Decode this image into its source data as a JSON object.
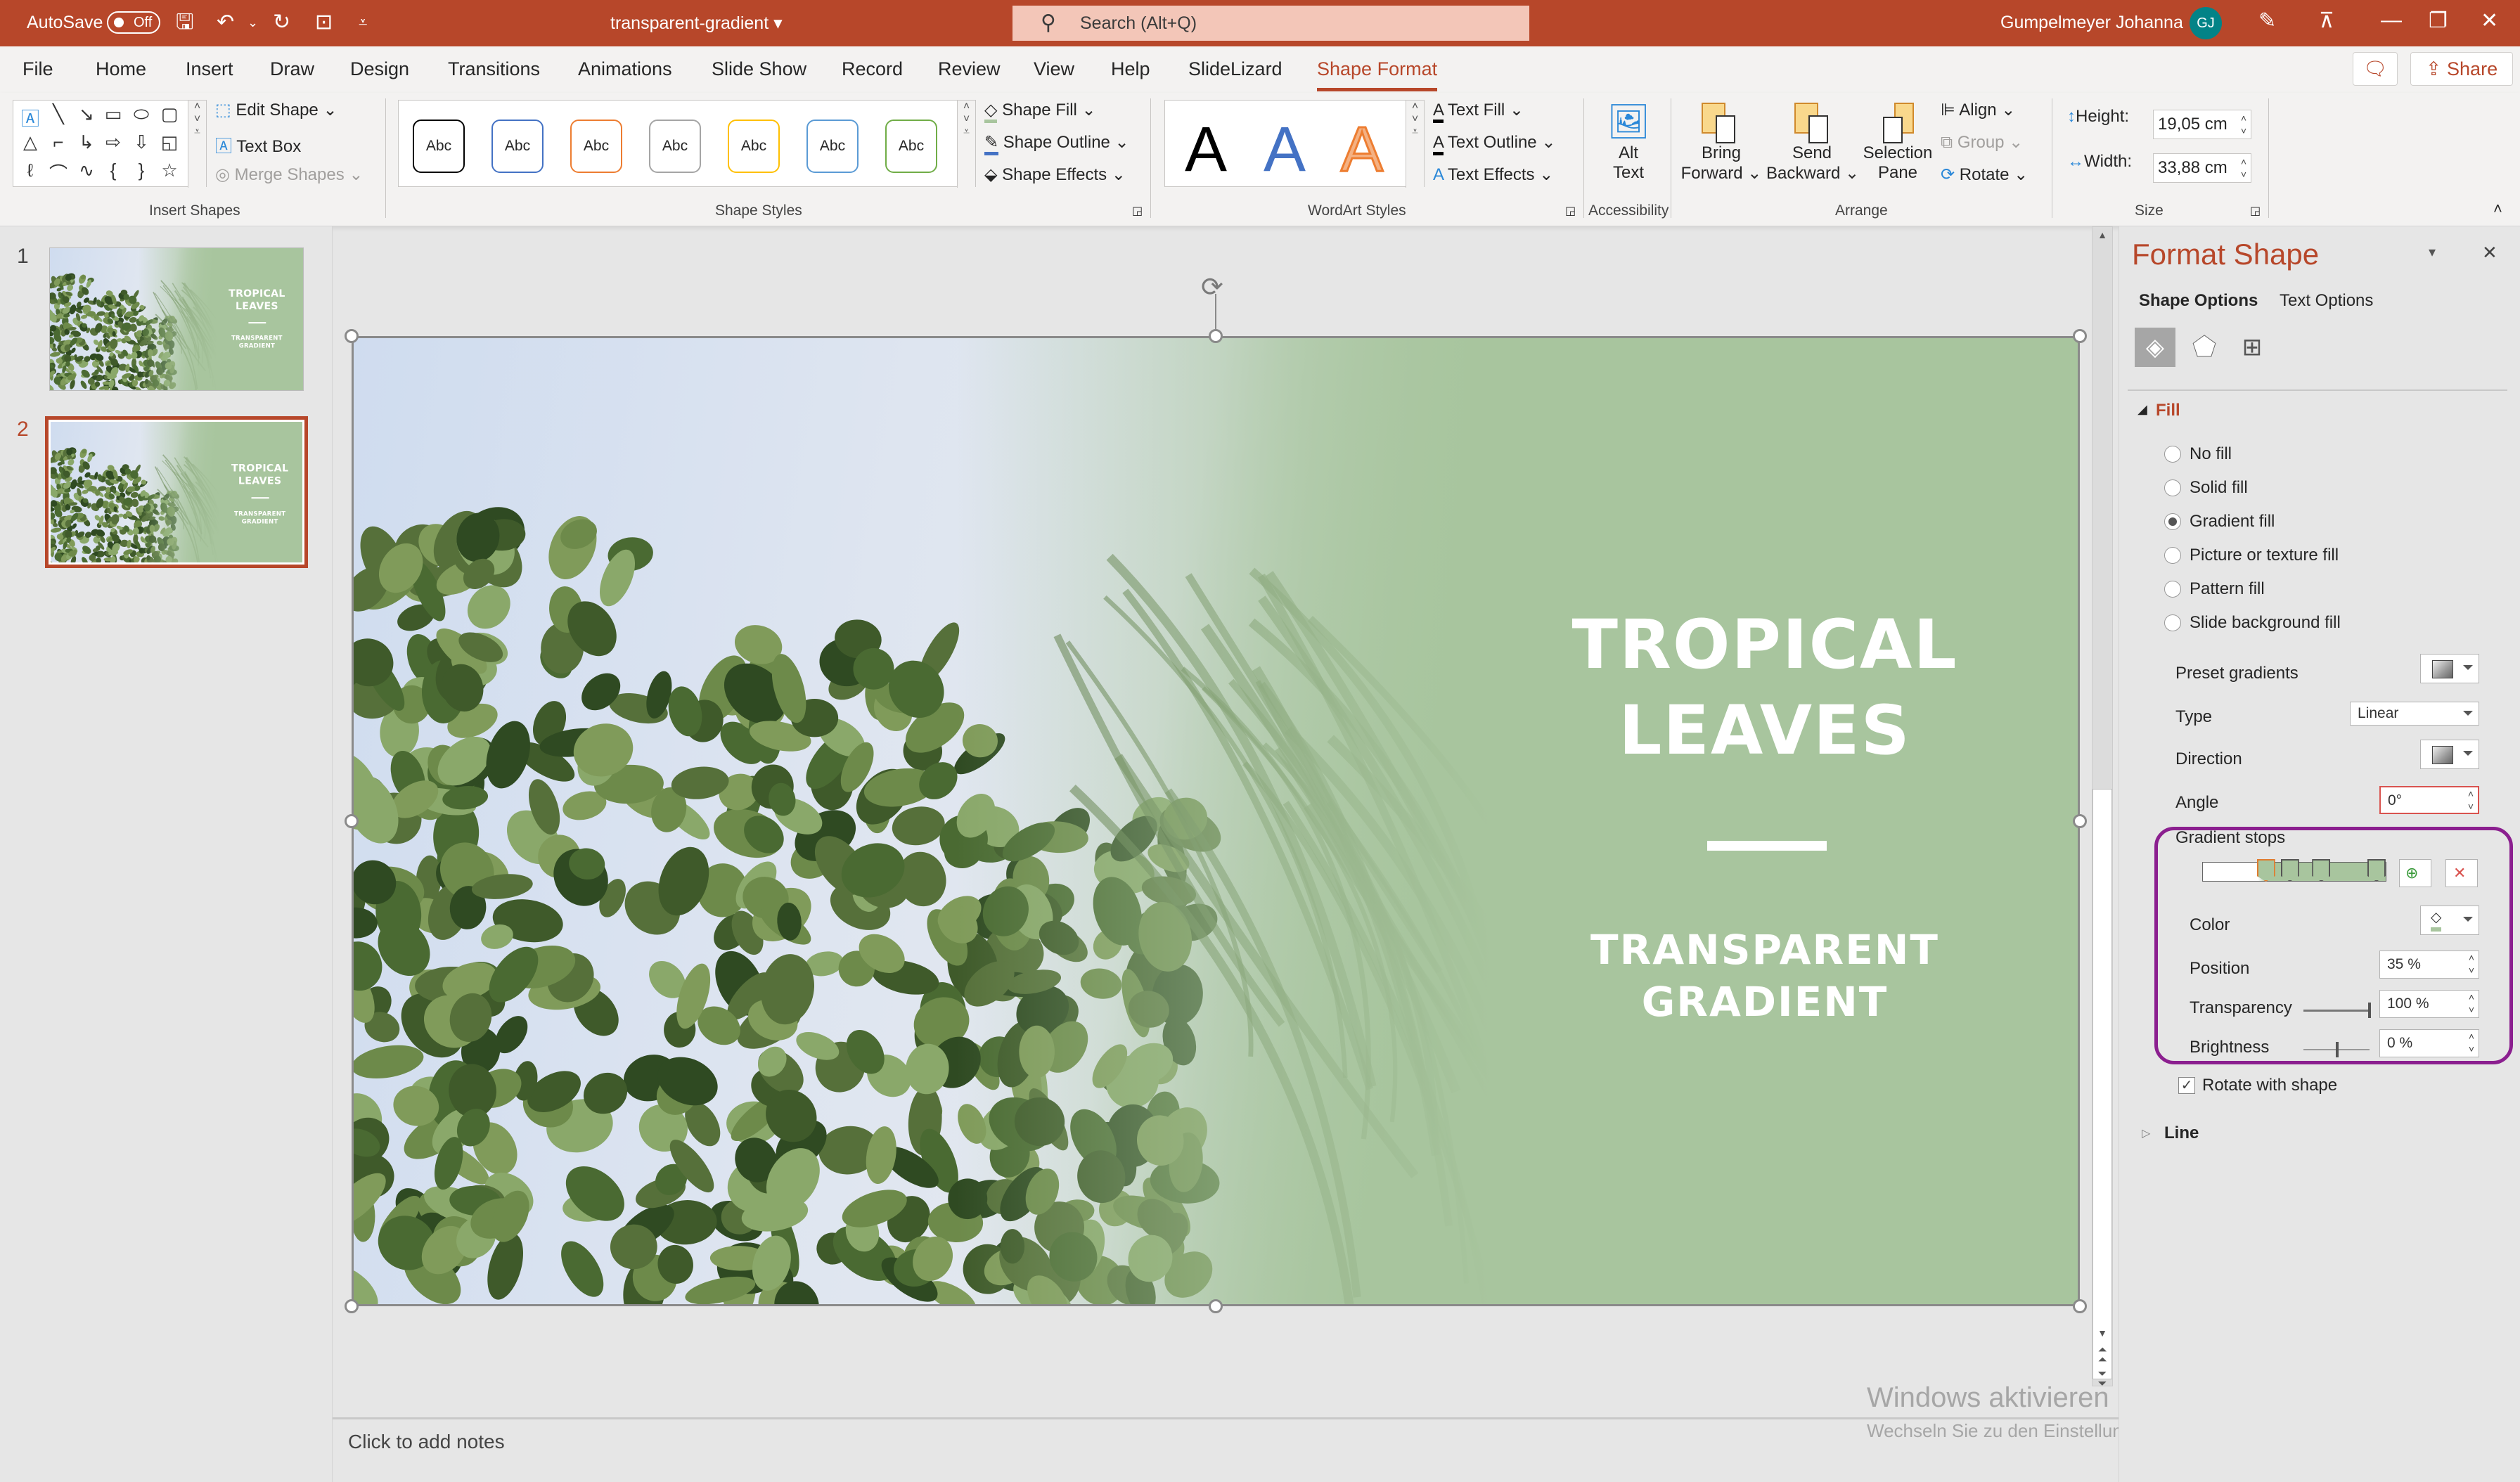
{
  "titlebar": {
    "autosave_label": "AutoSave",
    "autosave_state": "Off",
    "doc_title": "transparent-gradient",
    "search_placeholder": "Search (Alt+Q)",
    "user_name": "Gumpelmeyer Johanna",
    "user_initials": "GJ"
  },
  "tabs": [
    "File",
    "Home",
    "Insert",
    "Draw",
    "Design",
    "Transitions",
    "Animations",
    "Slide Show",
    "Record",
    "Review",
    "View",
    "Help",
    "SlideLizard",
    "Shape Format"
  ],
  "active_tab": "Shape Format",
  "share_label": "Share",
  "ribbon": {
    "insert_shapes": {
      "label": "Insert Shapes",
      "edit_shape": "Edit Shape",
      "text_box": "Text Box",
      "merge_shapes": "Merge Shapes"
    },
    "shape_styles": {
      "label": "Shape Styles",
      "presets": [
        "Abc",
        "Abc",
        "Abc",
        "Abc",
        "Abc",
        "Abc",
        "Abc"
      ],
      "preset_colors": [
        "#000000",
        "#4472c4",
        "#ed7d31",
        "#a5a5a5",
        "#ffc000",
        "#5b9bd5",
        "#70ad47"
      ],
      "shape_fill": "Shape Fill",
      "shape_outline": "Shape Outline",
      "shape_effects": "Shape Effects"
    },
    "wordart_styles": {
      "label": "WordArt Styles",
      "presets": [
        "A",
        "A",
        "A"
      ],
      "text_fill": "Text Fill",
      "text_outline": "Text Outline",
      "text_effects": "Text Effects"
    },
    "accessibility": {
      "label": "Accessibility",
      "alt_text_1": "Alt",
      "alt_text_2": "Text"
    },
    "arrange": {
      "label": "Arrange",
      "bring_forward_1": "Bring",
      "bring_forward_2": "Forward",
      "send_backward_1": "Send",
      "send_backward_2": "Backward",
      "selection_pane_1": "Selection",
      "selection_pane_2": "Pane",
      "align": "Align",
      "group": "Group",
      "rotate": "Rotate"
    },
    "size": {
      "label": "Size",
      "height_label": "Height:",
      "height_value": "19,05 cm",
      "width_label": "Width:",
      "width_value": "33,88 cm"
    }
  },
  "slides": [
    {
      "number": "1",
      "title": "TROPICAL LEAVES",
      "subtitle": "TRANSPARENT GRADIENT",
      "selected": false
    },
    {
      "number": "2",
      "title": "TROPICAL LEAVES",
      "subtitle": "TRANSPARENT GRADIENT",
      "selected": true
    }
  ],
  "slide": {
    "title_line1": "TROPICAL",
    "title_line2": "LEAVES",
    "subtitle_line1": "TRANSPARENT",
    "subtitle_line2": "GRADIENT",
    "accent_color": "#a8c59e"
  },
  "notes_placeholder": "Click to add notes",
  "watermark": {
    "title": "Windows aktivieren",
    "body": "Wechseln Sie zu den Einstellungen, um Windows zu aktivieren."
  },
  "format_panel": {
    "title": "Format Shape",
    "tab_shape_options": "Shape Options",
    "tab_text_options": "Text Options",
    "fill_section": "Fill",
    "fill_options": [
      {
        "label": "No fill",
        "selected": false
      },
      {
        "label": "Solid fill",
        "selected": false
      },
      {
        "label": "Gradient fill",
        "selected": true
      },
      {
        "label": "Picture or texture fill",
        "selected": false
      },
      {
        "label": "Pattern fill",
        "selected": false
      },
      {
        "label": "Slide background fill",
        "selected": false
      }
    ],
    "preset_gradients_label": "Preset gradients",
    "type_label": "Type",
    "type_value": "Linear",
    "direction_label": "Direction",
    "angle_label": "Angle",
    "angle_value": "0°",
    "gradient_stops_label": "Gradient stops",
    "gradient_stops": [
      {
        "position_pct": 35,
        "selected": true
      },
      {
        "position_pct": 48,
        "selected": false
      },
      {
        "position_pct": 65,
        "selected": false
      },
      {
        "position_pct": 95,
        "selected": false
      }
    ],
    "stop_color": "#a8c59e",
    "color_label": "Color",
    "position_label": "Position",
    "position_value": "35 %",
    "transparency_label": "Transparency",
    "transparency_value": "100 %",
    "transparency_pct": 100,
    "brightness_label": "Brightness",
    "brightness_value": "0 %",
    "brightness_pct": 0,
    "rotate_with_shape_label": "Rotate with shape",
    "rotate_with_shape": true,
    "line_section": "Line",
    "highlight_color": "#8b1f8f"
  }
}
